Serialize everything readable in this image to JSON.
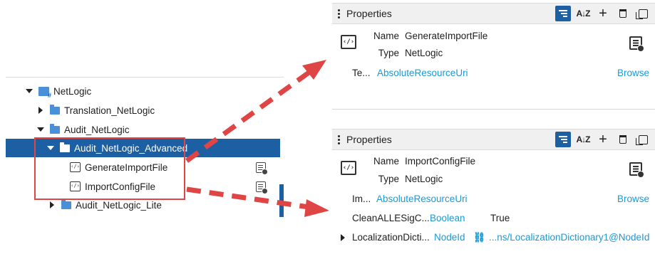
{
  "tree": {
    "root_label": "NetLogic",
    "items": [
      {
        "label": "Translation_NetLogic"
      },
      {
        "label": "Audit_NetLogic"
      },
      {
        "label": "Audit_NetLogic_Advanced"
      },
      {
        "label": "GenerateImportFile"
      },
      {
        "label": "ImportConfigFile"
      },
      {
        "label": "Audit_NetLogic_Lite"
      }
    ]
  },
  "properties_top": {
    "title": "Properties",
    "name_key": "Name",
    "name_value": "GenerateImportFile",
    "type_key": "Type",
    "type_value": "NetLogic",
    "rows": [
      {
        "name": "Te...",
        "type": "AbsoluteResourceUri",
        "action": "Browse"
      }
    ]
  },
  "properties_bottom": {
    "title": "Properties",
    "name_key": "Name",
    "name_value": "ImportConfigFile",
    "type_key": "Type",
    "type_value": "NetLogic",
    "rows": [
      {
        "name": "Im...",
        "type": "AbsoluteResourceUri",
        "action": "Browse"
      },
      {
        "name": "CleanALLESigC...",
        "type": "Boolean",
        "value": "True"
      },
      {
        "name": "LocalizationDicti...",
        "type": "NodeId",
        "value": "...ns/LocalizationDictionary1@NodeId"
      }
    ]
  },
  "colors": {
    "selection": "#1d5fa3",
    "folder": "#4a90d9",
    "link": "#1a9ad6",
    "annotation": "#e04545"
  },
  "icons": {
    "script": "netlogic-script-icon",
    "row_action": "edit-properties-icon",
    "link": "link-icon"
  }
}
